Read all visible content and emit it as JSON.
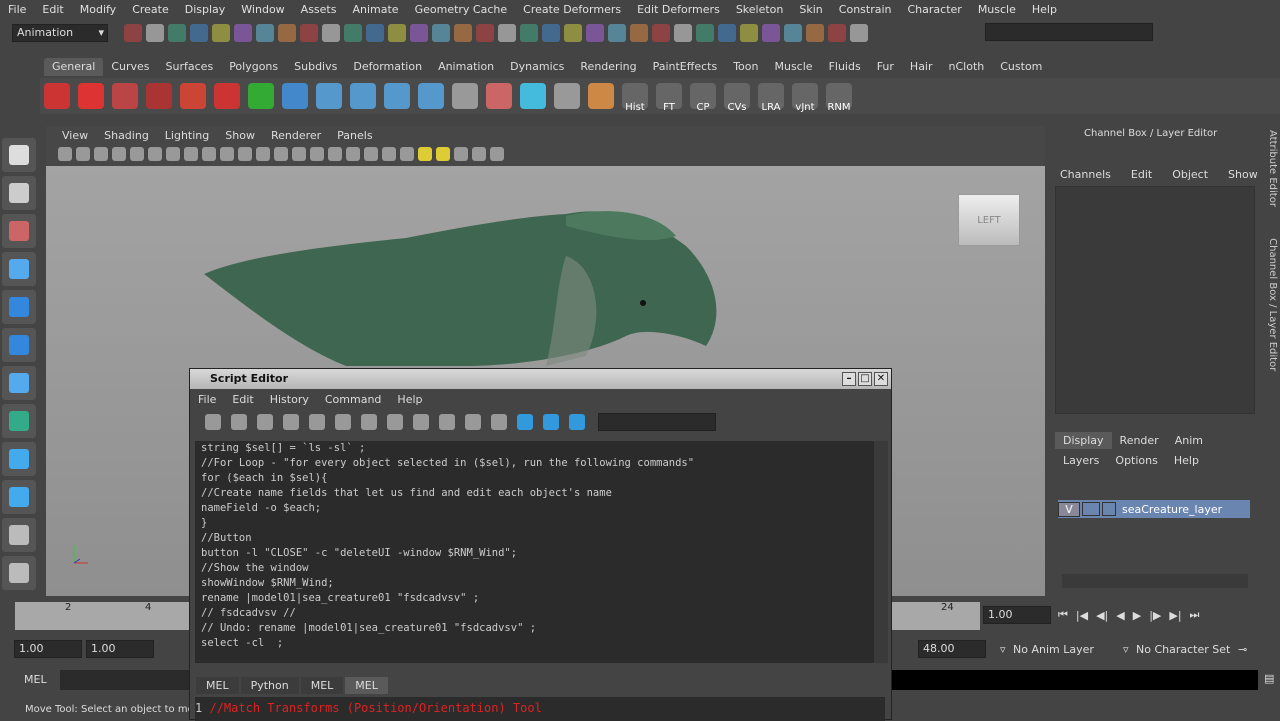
{
  "menubar": [
    "File",
    "Edit",
    "Modify",
    "Create",
    "Display",
    "Window",
    "Assets",
    "Animate",
    "Geometry Cache",
    "Create Deformers",
    "Edit Deformers",
    "Skeleton",
    "Skin",
    "Constrain",
    "Character",
    "Muscle",
    "Help"
  ],
  "status": {
    "menuset": "Animation"
  },
  "shelf": {
    "tabs": [
      "General",
      "Curves",
      "Surfaces",
      "Polygons",
      "Subdivs",
      "Deformation",
      "Animation",
      "Dynamics",
      "Rendering",
      "PaintEffects",
      "Toon",
      "Muscle",
      "Fluids",
      "Fur",
      "Hair",
      "nCloth",
      "Custom"
    ],
    "active": "General",
    "labeled_buttons": [
      "Hist",
      "FT",
      "CP",
      "CVs",
      "LRA",
      "vJnt",
      "RNM"
    ]
  },
  "viewport": {
    "menu": [
      "View",
      "Shading",
      "Lighting",
      "Show",
      "Renderer",
      "Panels"
    ],
    "viewcube": "LEFT"
  },
  "channelbox": {
    "title": "Channel Box / Layer Editor",
    "menu": [
      "Channels",
      "Edit",
      "Object",
      "Show"
    ],
    "layer_tabs": [
      "Display",
      "Render",
      "Anim"
    ],
    "layer_menu": [
      "Layers",
      "Options",
      "Help"
    ],
    "layer": {
      "visible": "V",
      "name": "seaCreature_layer"
    }
  },
  "side_tabs": [
    "Attribute Editor",
    "Channel Box / Layer Editor"
  ],
  "timeslider": {
    "ticks": [
      "2",
      "4",
      "24"
    ],
    "current": "1.00"
  },
  "range": {
    "start": "1.00",
    "start2": "1.00",
    "end": "48.00",
    "anim_layer": "No Anim Layer",
    "char_set": "No Character Set"
  },
  "cmdline": {
    "lang": "MEL"
  },
  "helpline": "Move Tool: Select an object to move",
  "script_editor": {
    "title": "Script Editor",
    "menu": [
      "File",
      "Edit",
      "History",
      "Command",
      "Help"
    ],
    "output": [
      "string $sel[] = `ls -sl` ;",
      "",
      "//For Loop - \"for every object selected in ($sel), run the following commands\"",
      "for ($each in $sel){",
      "//Create name fields that let us find and edit each object's name",
      "nameField -o $each;",
      "}",
      "//Button",
      "button -l \"CLOSE\" -c \"deleteUI -window $RNM_Wind\";",
      "//Show the window",
      "showWindow $RNM_Wind;",
      "rename |model01|sea_creature01 \"fsdcadvsv\" ;",
      "// fsdcadvsv //",
      "// Undo: rename |model01|sea_creature01 \"fsdcadvsv\" ;",
      "select -cl  ;"
    ],
    "tabs": [
      "MEL",
      "Python",
      "MEL",
      "MEL"
    ],
    "active_tab": 3,
    "input_line_no": "1",
    "input": "//Match Transforms (Position/Orientation) Tool"
  }
}
